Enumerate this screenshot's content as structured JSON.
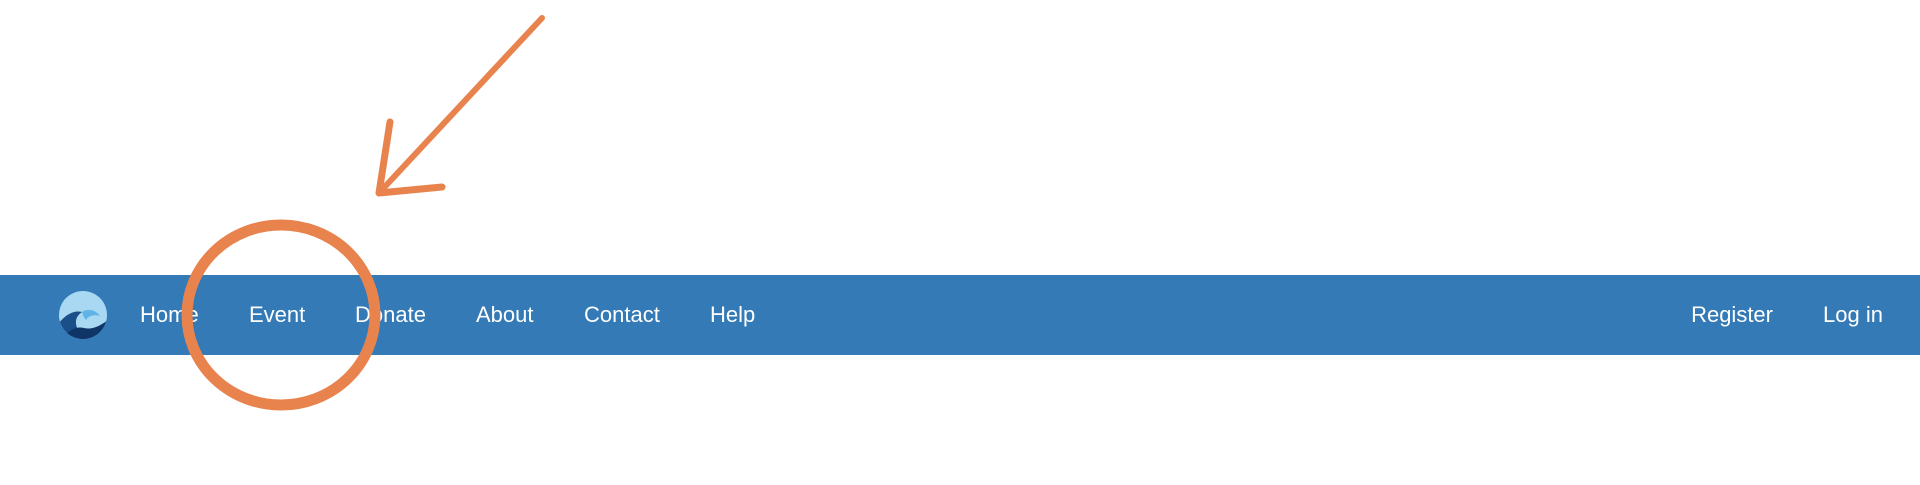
{
  "navbar": {
    "background_color": "#337ab7",
    "text_color": "#ffffff",
    "logo_icon": "wave-logo-icon",
    "left_items": [
      {
        "label": "Home"
      },
      {
        "label": "Event"
      },
      {
        "label": "Donate"
      },
      {
        "label": "About"
      },
      {
        "label": "Contact"
      },
      {
        "label": "Help"
      }
    ],
    "right_items": [
      {
        "label": "Register"
      },
      {
        "label": "Log in"
      }
    ]
  },
  "annotation": {
    "color": "#e8834e",
    "shapes": [
      "arrow",
      "circle"
    ],
    "highlighted_item": "Event"
  }
}
